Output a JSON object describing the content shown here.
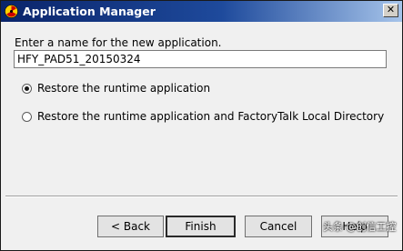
{
  "window": {
    "title": "Application Manager",
    "close_glyph": "✕"
  },
  "form": {
    "prompt": "Enter a name for the new application.",
    "name_value": "HFY_PAD51_20150324",
    "options": [
      {
        "label": "Restore the runtime application",
        "checked": true
      },
      {
        "label": "Restore the runtime application and FactoryTalk Local Directory",
        "checked": false
      }
    ]
  },
  "buttons": {
    "back": "< Back",
    "finish": "Finish",
    "cancel": "Cancel",
    "help": "Help"
  },
  "watermark": {
    "text": "头条 @创信工控"
  },
  "colors": {
    "titlebar_start": "#0a246a",
    "titlebar_end": "#a6c4ea",
    "dialog_bg": "#f0f0f0"
  },
  "icons": {
    "app": "radiation-icon"
  }
}
